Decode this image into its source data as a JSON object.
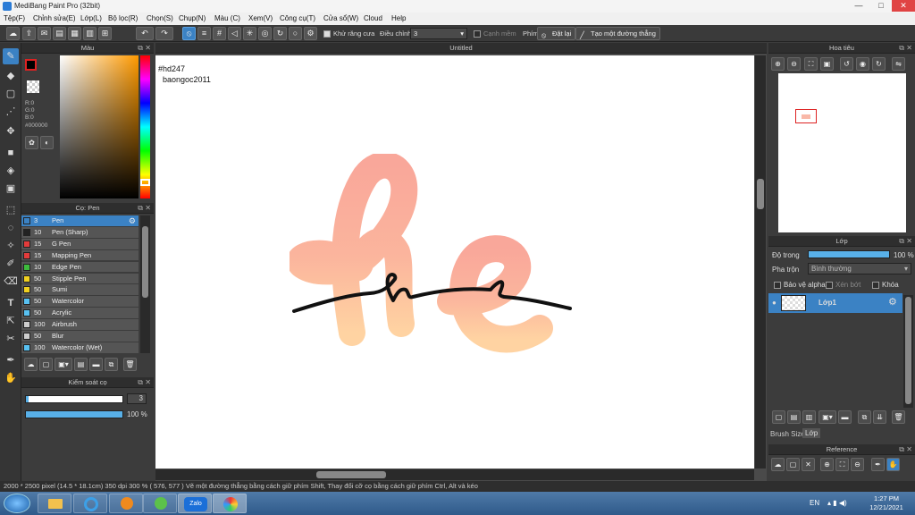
{
  "window": {
    "title": "MediBang Paint Pro (32bit)",
    "minimize": "—",
    "maximize": "□",
    "close": "✕"
  },
  "menu": [
    "Tệp(F)",
    "Chỉnh sửa(E)",
    "Lớp(L)",
    "Bộ lọc(R)",
    "Chọn(S)",
    "Chụp(N)",
    "Màu (C)",
    "Xem(V)",
    "Công cụ(T)",
    "Cửa sổ(W)",
    "Cloud",
    "Help"
  ],
  "toolbar": {
    "antialias_label": "Khử răng cưa",
    "correction_label": "Điều chỉnh",
    "correction_value": "3",
    "edge_label": "Cạnh mềm",
    "phim_label": "Phím",
    "reset_label": "Đặt lại",
    "straight_line_label": "Tạo một đường thẳng"
  },
  "color_panel": {
    "title": "Màu",
    "r": "R:0",
    "g": "G:0",
    "b": "B:0",
    "hex": "#000000"
  },
  "brush_panel": {
    "title": "Cọ: Pen",
    "brushes": [
      {
        "size": "3",
        "name": "Pen",
        "color": "#3b82c4"
      },
      {
        "size": "10",
        "name": "Pen (Sharp)",
        "color": "#222222"
      },
      {
        "size": "15",
        "name": "G Pen",
        "color": "#e23b3b"
      },
      {
        "size": "15",
        "name": "Mapping Pen",
        "color": "#e23b3b"
      },
      {
        "size": "10",
        "name": "Edge Pen",
        "color": "#3dbb3d"
      },
      {
        "size": "50",
        "name": "Stipple Pen",
        "color": "#f0d020"
      },
      {
        "size": "50",
        "name": "Sumi",
        "color": "#f0d020"
      },
      {
        "size": "50",
        "name": "Watercolor",
        "color": "#58c0f0"
      },
      {
        "size": "50",
        "name": "Acrylic",
        "color": "#58c0f0"
      },
      {
        "size": "100",
        "name": "Airbrush",
        "color": "#cccccc"
      },
      {
        "size": "50",
        "name": "Blur",
        "color": "#cccccc"
      },
      {
        "size": "100",
        "name": "Watercolor (Wet)",
        "color": "#58c0f0"
      }
    ]
  },
  "brush_control": {
    "title": "Kiểm soát cọ",
    "size_value": "3",
    "opacity_value": "100 %"
  },
  "canvas": {
    "tab_title": "Untitled",
    "text_line1": "#hd247",
    "text_line2": "baongoc2011"
  },
  "navigator": {
    "title": "Hoa tiêu"
  },
  "layer_panel": {
    "title": "Lớp",
    "opacity_label": "Độ trong",
    "opacity_value": "100 %",
    "opacity_fraction": 1.0,
    "blend_label": "Pha trộn",
    "blend_value": "Bình thường",
    "protect_alpha": "Bảo vệ alpha",
    "clipping": "Xén bớt",
    "lock": "Khóa",
    "layer_name": "Lớp1",
    "tab_brush_size": "Brush Size",
    "tab_layer": "Lớp"
  },
  "reference_panel": {
    "title": "Reference"
  },
  "status": {
    "text": "2000 * 2500 pixel   (14.5 * 18.1cm)   350 dpi   300 %   ( 576, 577 )   Vẽ một đường thẳng bằng cách giữ phím Shift, Thay đổi cỡ cọ bằng cách giữ phím Ctrl, Alt và kéo"
  },
  "taskbar": {
    "zalo_label": "Zalo",
    "lang": "EN",
    "time": "1:27 PM",
    "date": "12/21/2021"
  },
  "colors": {
    "accent": "#3b82c4",
    "stroke_pink": "#f9a79a",
    "stroke_peach": "#ffcfa0"
  }
}
